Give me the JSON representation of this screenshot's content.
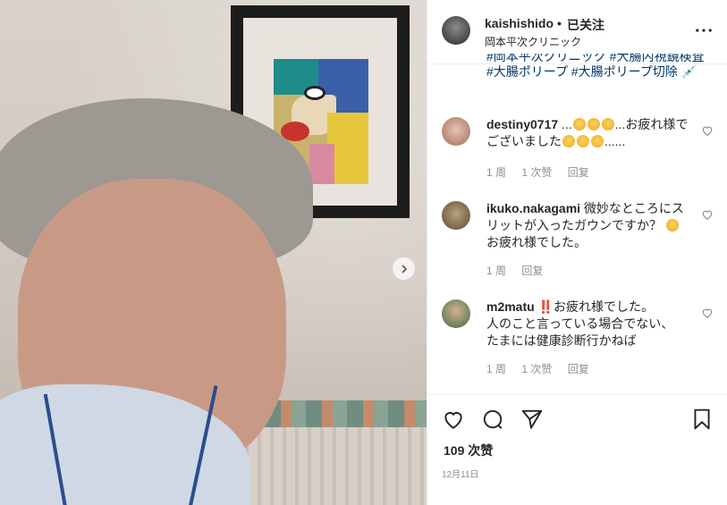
{
  "post": {
    "username": "kaishishido",
    "separator": "•",
    "follow_status": "已关注",
    "location": "岡本平次クリニック",
    "more_icon": "more-icon",
    "tags_partial": "#岡本平次クリニック #大腸内視鏡検査",
    "tags_line": "#大腸ポリープ #大腸ポリープ切除 💉",
    "likes": "109 次赞",
    "date": "12月11日"
  },
  "comments": [
    {
      "username": "destiny0717",
      "text": " ...🥺🥺🥺...お疲れ様でございました🥺🥺🥺......",
      "text_a": " ...",
      "text_b": "...お疲れ様でございました",
      "text_c": "......",
      "time": "1 周",
      "likes": "1 次赞",
      "reply": "回复"
    },
    {
      "username": "ikuko.nakagami",
      "text": " 微妙なところにスリットが入ったガウンですか？ 😅 お疲れ様でした。",
      "text_a": " 微妙なところにスリットが入ったガウンですか？ ",
      "text_b": "お疲れ様でした。",
      "time": "1 周",
      "reply": "回复"
    },
    {
      "username": "m2matu",
      "bang": "‼️",
      "text": "お疲れ様でした。人のこと言っている場合でない、たまには健康診断行かねば",
      "text_a": "お疲れ様でした。",
      "text_b": "人のこと言っている場合でない、",
      "text_c": "たまには健康診断行かねば",
      "time": "1 周",
      "likes": "1 次赞",
      "reply": "回复"
    }
  ],
  "icons": {
    "like": "heart-icon",
    "comment": "comment-icon",
    "share": "send-icon",
    "save": "bookmark-icon",
    "next": "chevron-right-icon"
  }
}
